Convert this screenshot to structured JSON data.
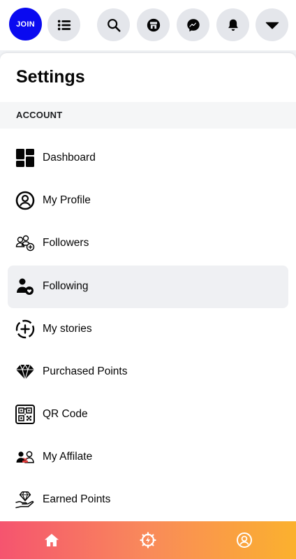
{
  "header": {
    "join_label": "JOIN",
    "icons": [
      "menu-icon",
      "search-icon",
      "store-icon",
      "messenger-icon",
      "bell-icon",
      "caret-down-icon"
    ]
  },
  "settings": {
    "title": "Settings",
    "section_label": "ACCOUNT",
    "items": [
      {
        "label": "Dashboard",
        "icon": "dashboard-icon"
      },
      {
        "label": "My Profile",
        "icon": "profile-icon"
      },
      {
        "label": "Followers",
        "icon": "followers-icon"
      },
      {
        "label": "Following",
        "icon": "following-icon",
        "active": true
      },
      {
        "label": "My stories",
        "icon": "stories-icon"
      },
      {
        "label": "Purchased Points",
        "icon": "diamond-icon"
      },
      {
        "label": "QR Code",
        "icon": "qr-code-icon"
      },
      {
        "label": "My Affilate",
        "icon": "affiliate-icon"
      },
      {
        "label": "Earned Points",
        "icon": "earned-points-icon"
      }
    ]
  },
  "bottom_nav": {
    "icons": [
      "home-icon",
      "bolt-gear-icon",
      "account-icon"
    ],
    "gradient": [
      "#f5546f",
      "#fbb12e"
    ]
  },
  "colors": {
    "join_button": "#0a0af0",
    "icon_button_bg": "#e4e6eb",
    "active_item_bg": "#eff0f3"
  }
}
